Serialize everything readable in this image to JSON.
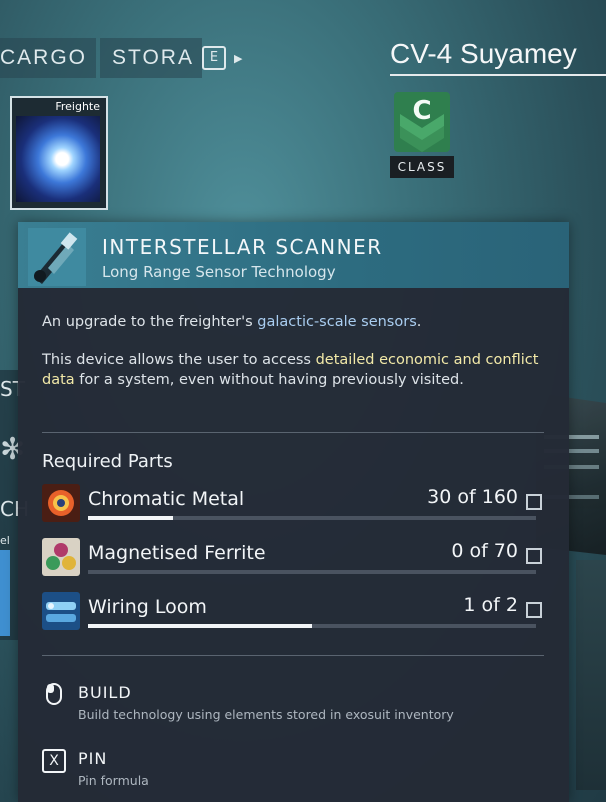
{
  "tabs": [
    {
      "label": "CARGO"
    },
    {
      "label": "STORA"
    }
  ],
  "tab_key": "E",
  "ship_name": "CV-4 Suyamey",
  "class": {
    "letter": "C",
    "label": "CLASS"
  },
  "slot": {
    "label": "Freighte"
  },
  "side": {
    "st": "ST",
    "ch": "CH",
    "el": "el"
  },
  "tooltip": {
    "title": "INTERSTELLAR SCANNER",
    "subtitle": "Long Range Sensor Technology",
    "desc1_a": "An upgrade to the freighter's ",
    "desc1_hl": "galactic-scale sensors",
    "desc1_b": ".",
    "desc2_a": "This device allows the user to access ",
    "desc2_hl": "detailed economic and conflict data",
    "desc2_b": " for a system, even without having previously visited.",
    "required_title": "Required Parts",
    "parts": [
      {
        "name": "Chromatic Metal",
        "count": "30 of 160",
        "progress": 0.19
      },
      {
        "name": "Magnetised Ferrite",
        "count": "0 of 70",
        "progress": 0
      },
      {
        "name": "Wiring Loom",
        "count": "1 of 2",
        "progress": 0.5
      }
    ],
    "actions": [
      {
        "label": "BUILD",
        "sub": "Build technology using elements stored in exosuit inventory"
      },
      {
        "key": "X",
        "label": "PIN",
        "sub": "Pin formula"
      }
    ]
  },
  "colors": {
    "header": "#3a7f93",
    "highlight_blue": "#a9cdf0",
    "highlight_yellow": "#f2e9a8",
    "class_green": "#2f7f4e"
  }
}
